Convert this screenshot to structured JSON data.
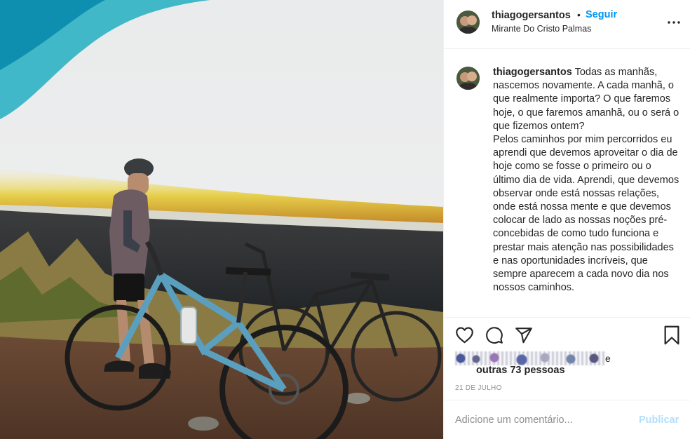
{
  "post": {
    "username": "thiagogersantos",
    "separator": "•",
    "follow_label": "Seguir",
    "location": "Mirante Do Cristo Palmas",
    "more_icon": "more-options-icon",
    "caption_text": "Todas as manhãs, nascemos novamente. A cada manhã, o que realmente importa? O que faremos hoje, o que faremos amanhã, ou o será o que fizemos ontem?\nPelos caminhos por mim percorridos eu aprendi que devemos aproveitar o dia de hoje como se fosse o primeiro ou o último dia de vida. Aprendi, que devemos observar onde está nossas relações, onde está nossa mente e que devemos colocar de lado as nossas noções pré-concebidas de como tudo funciona e prestar mais atenção nas possibilidades e nas oportunidades incríveis, que sempre aparecem a cada novo dia nos nossos caminhos."
  },
  "actions": {
    "icons": [
      "heart-icon",
      "comment-icon",
      "share-icon",
      "bookmark-icon"
    ]
  },
  "likes": {
    "line1_suffix": "e",
    "line2": "outras 73 pessoas"
  },
  "date": "21 DE JULHO",
  "comment": {
    "placeholder": "Adicione um comentário...",
    "publish_label": "Publicar"
  },
  "colors": {
    "link_blue": "#0095f6",
    "publish_disabled": "#b2dffc",
    "muted": "#8e8e8e",
    "divider": "#efefef"
  }
}
